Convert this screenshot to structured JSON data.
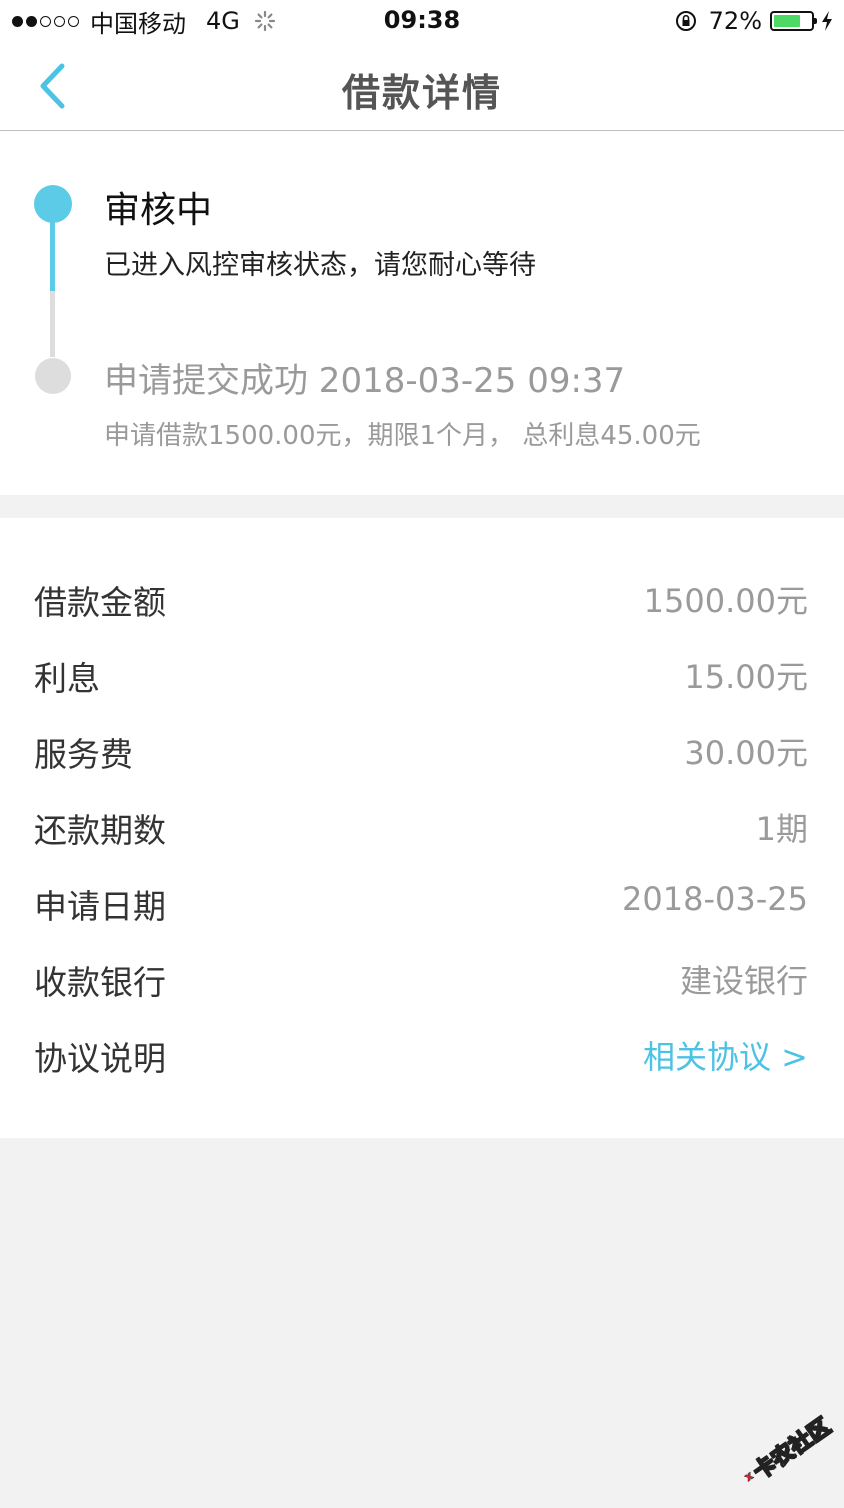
{
  "status_bar": {
    "carrier": "中国移动",
    "network": "4G",
    "time": "09:38",
    "battery_percent": "72%",
    "battery_level": 0.72,
    "signal_bars_on": 2,
    "signal_bars_total": 5,
    "icons": [
      "loading-spinner-icon",
      "orientation-lock-icon",
      "battery-icon",
      "charging-bolt-icon"
    ]
  },
  "nav": {
    "title": "借款详情",
    "back_icon": "chevron-left-icon"
  },
  "timeline": {
    "steps": [
      {
        "title": "审核中",
        "desc": "已进入风控审核状态，请您耐心等待",
        "state": "active"
      },
      {
        "title": "申请提交成功 2018-03-25 09:37",
        "desc": "申请借款1500.00元，期限1个月， 总利息45.00元",
        "state": "done"
      }
    ]
  },
  "details": {
    "rows": [
      {
        "label": "借款金额",
        "value": "1500.00元"
      },
      {
        "label": "利息",
        "value": "15.00元"
      },
      {
        "label": "服务费",
        "value": "30.00元"
      },
      {
        "label": "还款期数",
        "value": "1期"
      },
      {
        "label": "申请日期",
        "value": "2018-03-25"
      },
      {
        "label": "收款银行",
        "value": "建设银行"
      },
      {
        "label": "协议说明",
        "value": "相关协议 >"
      }
    ]
  },
  "watermark": {
    "text": "卡农社区"
  },
  "colors": {
    "accent": "#5ccbe8",
    "link": "#4cc2e4",
    "muted_text": "#9a9a9a",
    "background": "#f2f2f2",
    "battery_green": "#4cd964"
  }
}
